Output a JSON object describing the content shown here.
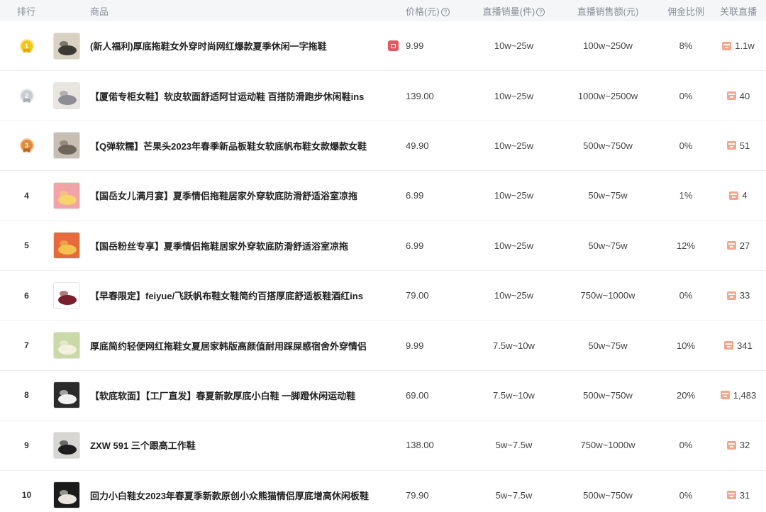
{
  "header": {
    "rank": "排行",
    "product": "商品",
    "price": "价格(元)",
    "sales": "直播销量(件)",
    "gmv": "直播销售额(元)",
    "commission": "佣金比例",
    "live": "关联直播"
  },
  "colors": {
    "gold": "#f5c518",
    "silver": "#c9ccd2",
    "bronze": "#e08a3a",
    "live_icon": "#f5a58a"
  },
  "rows": [
    {
      "rank": "1",
      "medal": "gold",
      "name": "(新人福利)厚底拖鞋女外穿时尚网红爆款夏季休闲一字拖鞋",
      "gift": true,
      "price": "9.99",
      "sales": "10w~25w",
      "gmv": "100w~250w",
      "commission": "8%",
      "live": "1.1w",
      "thumb": [
        "#d9d2c3",
        "#3c3a36"
      ]
    },
    {
      "rank": "2",
      "medal": "silver",
      "name": "【厦偌专柜女鞋】软皮软面舒适阿甘运动鞋 百搭防滑跑步休闲鞋ins",
      "gift": false,
      "price": "139.00",
      "sales": "10w~25w",
      "gmv": "1000w~2500w",
      "commission": "0%",
      "live": "40",
      "thumb": [
        "#e9e6e1",
        "#8d8d93"
      ]
    },
    {
      "rank": "3",
      "medal": "bronze",
      "name": "【Q弹软糯】芒果头2023年春季新品板鞋女软底帆布鞋女款爆款女鞋",
      "gift": false,
      "price": "49.90",
      "sales": "10w~25w",
      "gmv": "500w~750w",
      "commission": "0%",
      "live": "51",
      "thumb": [
        "#c8bfb3",
        "#6f655a"
      ]
    },
    {
      "rank": "4",
      "medal": "",
      "name": "【国岳女儿满月宴】夏季情侣拖鞋居家外穿软底防滑舒适浴室凉拖",
      "gift": false,
      "price": "6.99",
      "sales": "10w~25w",
      "gmv": "50w~75w",
      "commission": "1%",
      "live": "4",
      "thumb": [
        "#f1a3a8",
        "#f7d36b"
      ]
    },
    {
      "rank": "5",
      "medal": "",
      "name": "【国岳粉丝专享】夏季情侣拖鞋居家外穿软底防滑舒适浴室凉拖",
      "gift": false,
      "price": "6.99",
      "sales": "10w~25w",
      "gmv": "50w~75w",
      "commission": "12%",
      "live": "27",
      "thumb": [
        "#e66a3c",
        "#f2c14e"
      ]
    },
    {
      "rank": "6",
      "medal": "",
      "name": "【早春限定】feiyue/飞跃帆布鞋女鞋简约百搭厚底舒适板鞋酒红ins",
      "gift": false,
      "price": "79.00",
      "sales": "10w~25w",
      "gmv": "750w~1000w",
      "commission": "0%",
      "live": "33",
      "thumb": [
        "#ffffff",
        "#7a1f2b"
      ]
    },
    {
      "rank": "7",
      "medal": "",
      "name": "厚底简约轻便网红拖鞋女夏居家韩版高颜值耐用踩屎感宿舍外穿情侣",
      "gift": false,
      "price": "9.99",
      "sales": "7.5w~10w",
      "gmv": "50w~75w",
      "commission": "10%",
      "live": "341",
      "thumb": [
        "#c9d9a8",
        "#f3f0de"
      ]
    },
    {
      "rank": "8",
      "medal": "",
      "name": "【软底软面】【工厂直发】春夏新款厚底小白鞋 一脚蹬休闲运动鞋",
      "gift": false,
      "price": "69.00",
      "sales": "7.5w~10w",
      "gmv": "500w~750w",
      "commission": "20%",
      "live": "1,483",
      "thumb": [
        "#2b2b2b",
        "#f1f1f1"
      ]
    },
    {
      "rank": "9",
      "medal": "",
      "name": "ZXW 591 三个跟高工作鞋",
      "gift": false,
      "price": "138.00",
      "sales": "5w~7.5w",
      "gmv": "750w~1000w",
      "commission": "0%",
      "live": "32",
      "thumb": [
        "#d8d6d3",
        "#1e1e1e"
      ]
    },
    {
      "rank": "10",
      "medal": "",
      "name": "回力小白鞋女2023年春夏季新款原创小众熊猫情侣厚底增高休闲板鞋",
      "gift": false,
      "price": "79.90",
      "sales": "5w~7.5w",
      "gmv": "500w~750w",
      "commission": "0%",
      "live": "31",
      "thumb": [
        "#1b1b1b",
        "#e8e5df"
      ]
    }
  ]
}
